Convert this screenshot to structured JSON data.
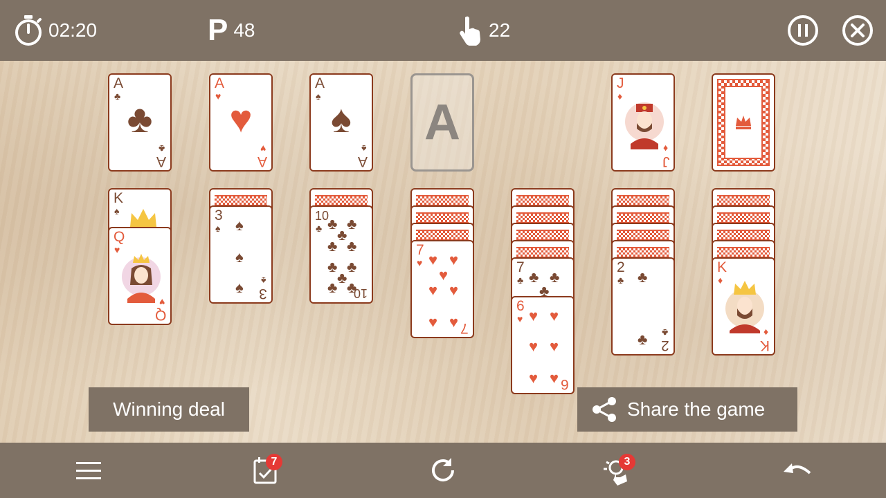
{
  "topbar": {
    "timer_icon": "stopwatch-icon",
    "timer": "02:20",
    "points_icon": "points-p-icon",
    "points": "48",
    "moves_icon": "tap-hand-icon",
    "moves": "22",
    "pause_icon": "pause-icon",
    "close_icon": "close-icon"
  },
  "foundations": [
    {
      "rank": "A",
      "suit": "♣",
      "color": "brown"
    },
    {
      "rank": "A",
      "suit": "♥",
      "color": "red"
    },
    {
      "rank": "A",
      "suit": "♠",
      "color": "brown"
    },
    {
      "empty_label": "A"
    }
  ],
  "waste": {
    "rank": "J",
    "suit": "♦",
    "color": "red"
  },
  "tableau": {
    "col1": [
      {
        "rank": "K",
        "suit": "♠"
      },
      {
        "rank": "Q",
        "suit": "♥"
      }
    ],
    "col2": [
      {
        "rank": "3",
        "suit": "♠"
      }
    ],
    "col3": [
      {
        "rank": "10",
        "suit": "♣"
      }
    ],
    "col4": [
      {
        "rank": "7",
        "suit": "♥"
      }
    ],
    "col5": [
      {
        "rank": "7",
        "suit": "♣"
      },
      {
        "rank": "6",
        "suit": "♥"
      }
    ],
    "col6": [
      {
        "rank": "2",
        "suit": "♣"
      }
    ],
    "col7": [
      {
        "rank": "K",
        "suit": "♦"
      }
    ]
  },
  "buttons": {
    "winning_deal": "Winning deal",
    "share_game": "Share the game"
  },
  "bottombar": {
    "menu_icon": "hamburger-menu-icon",
    "daily_icon": "calendar-check-icon",
    "daily_badge": "7",
    "restart_icon": "restart-icon",
    "hint_icon": "hint-lightbulb-icon",
    "hint_badge": "3",
    "undo_icon": "undo-icon"
  },
  "colors": {
    "bar": "#7f7265",
    "card_border": "#8b3a1d",
    "red_suit": "#e35b3c",
    "black_suit": "#7a4a33",
    "badge": "#e53935"
  }
}
